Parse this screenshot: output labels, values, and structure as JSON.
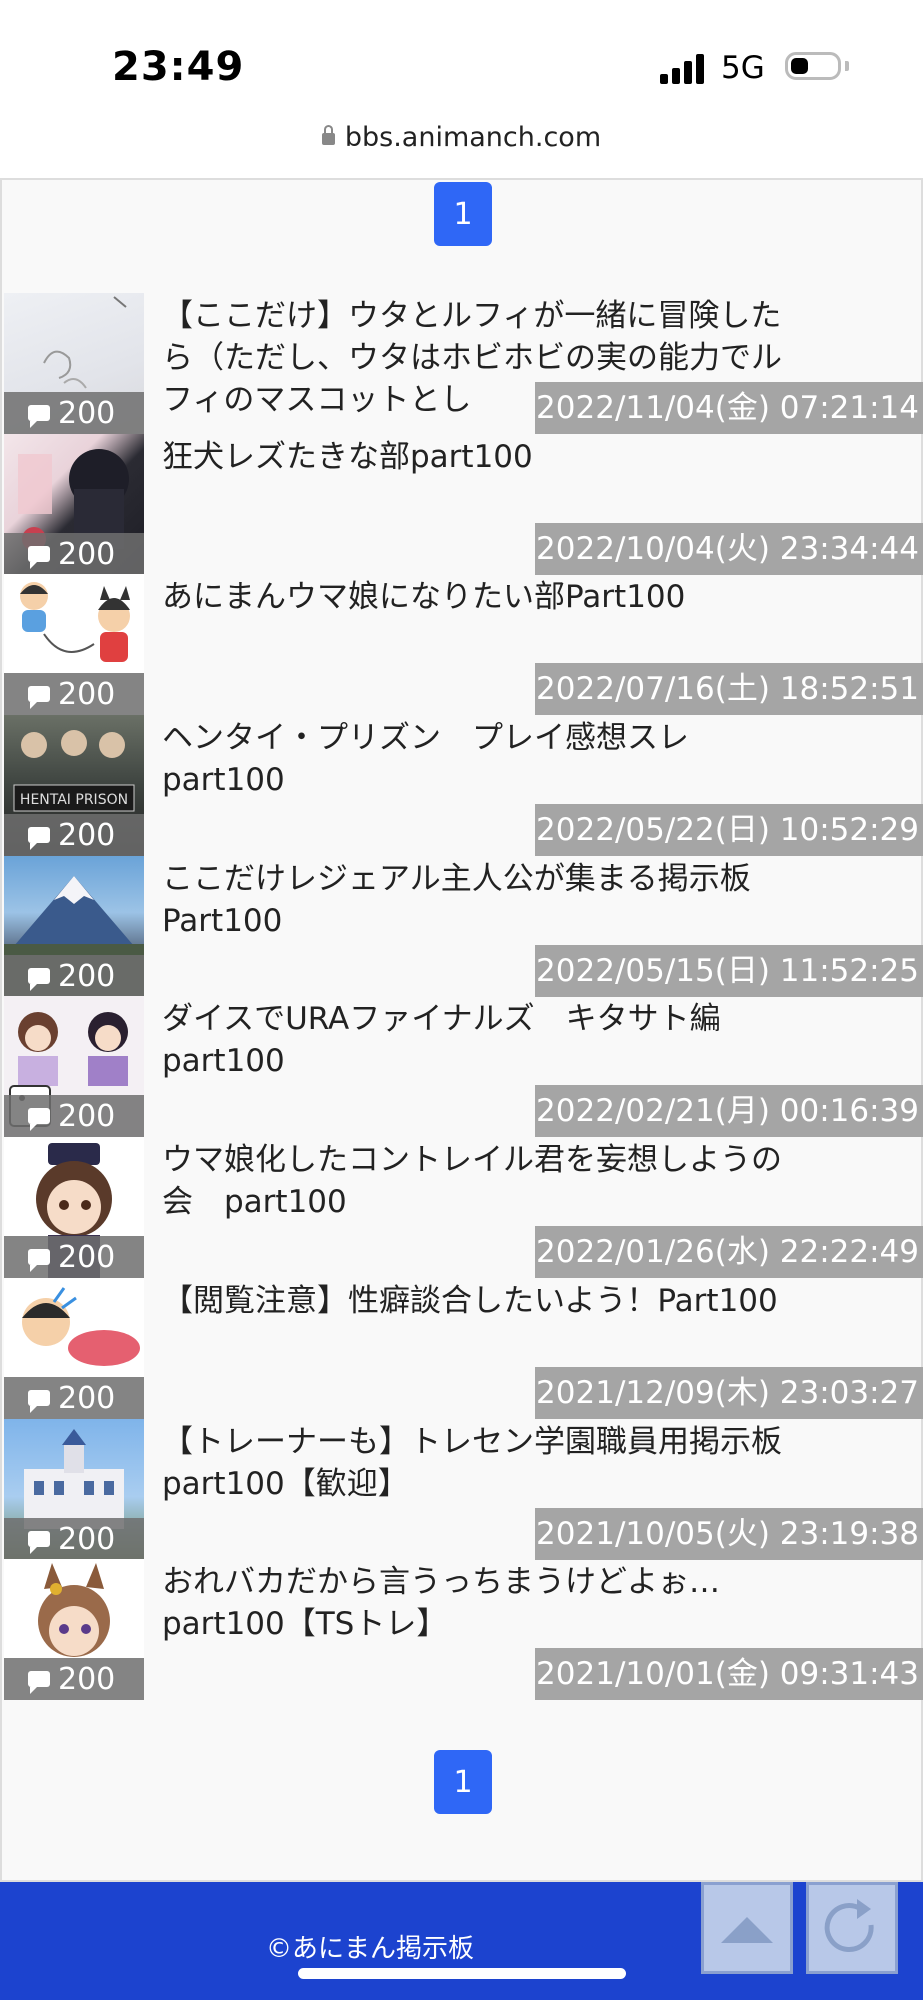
{
  "status_bar": {
    "time": "23:49",
    "network": "5G"
  },
  "browser": {
    "url": "bbs.animanch.com"
  },
  "pagination": {
    "current_page": "1"
  },
  "threads": [
    {
      "count": "200",
      "title": "【ここだけ】ウタとルフィが一緒に冒険したら（ただし、ウタはホビホビの実の能力でルフィのマスコットとし",
      "date": "2022/11/04(金) 07:21:14"
    },
    {
      "count": "200",
      "title": "狂犬レズたきな部part100",
      "date": "2022/10/04(火) 23:34:44"
    },
    {
      "count": "200",
      "title": "あにまんウマ娘になりたい部Part100",
      "date": "2022/07/16(土) 18:52:51"
    },
    {
      "count": "200",
      "title": "ヘンタイ・プリズン　プレイ感想スレpart100",
      "date": "2022/05/22(日) 10:52:29"
    },
    {
      "count": "200",
      "title": "ここだけレジェアル主人公が集まる掲示板Part100",
      "date": "2022/05/15(日) 11:52:25"
    },
    {
      "count": "200",
      "title": "ダイスでURAファイナルズ　キタサト編part100",
      "date": "2022/02/21(月) 00:16:39"
    },
    {
      "count": "200",
      "title": "ウマ娘化したコントレイル君を妄想しようの会　part100",
      "date": "2022/01/26(水) 22:22:49"
    },
    {
      "count": "200",
      "title": "【閲覧注意】性癖談合したいよう！Part100",
      "date": "2021/12/09(木) 23:03:27"
    },
    {
      "count": "200",
      "title": "【トレーナーも】トレセン学園職員用掲示板part100【歓迎】",
      "date": "2021/10/05(火) 23:19:38"
    },
    {
      "count": "200",
      "title": "おれバカだから言うっちまうけどよぉ… part100【TSトレ】",
      "date": "2021/10/01(金) 09:31:43"
    }
  ],
  "footer": {
    "copyright": "©あにまん掲示板"
  },
  "colors": {
    "accent": "#2f67f6",
    "footer": "#1c43cf",
    "date_bg": "#a5a5a5"
  }
}
